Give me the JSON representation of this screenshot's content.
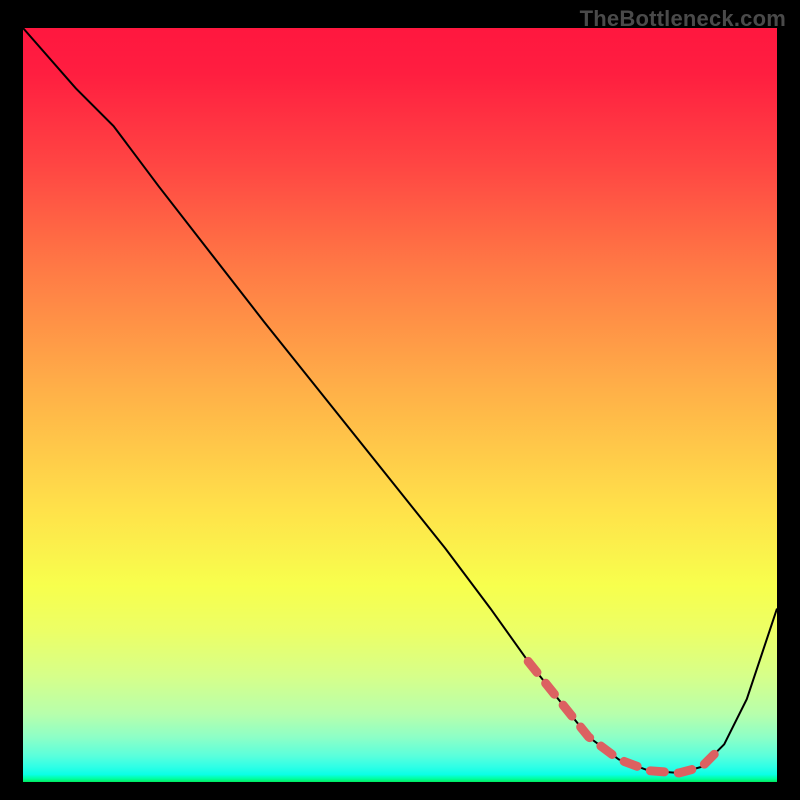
{
  "watermark": "TheBottleneck.com",
  "chart_data": {
    "type": "line",
    "title": "",
    "xlabel": "",
    "ylabel": "",
    "xlim": [
      0,
      100
    ],
    "ylim": [
      0,
      100
    ],
    "grid": false,
    "series": [
      {
        "name": "curve",
        "x": [
          0,
          7,
          12,
          18,
          25,
          32,
          40,
          48,
          56,
          62,
          67,
          71,
          75,
          79,
          83,
          87,
          90,
          93,
          96,
          100
        ],
        "y": [
          100,
          92,
          87,
          79,
          70,
          61,
          51,
          41,
          31,
          23,
          16,
          11,
          6,
          3,
          1.5,
          1.2,
          2,
          5,
          11,
          23
        ],
        "stroke": "#000000"
      },
      {
        "name": "optimal-zone-dashed",
        "x": [
          67,
          71,
          75,
          79,
          83,
          87,
          90,
          92
        ],
        "y": [
          16,
          11,
          6,
          3,
          1.5,
          1.2,
          2,
          4
        ],
        "stroke": "#dc6161",
        "dashed": true
      }
    ]
  }
}
